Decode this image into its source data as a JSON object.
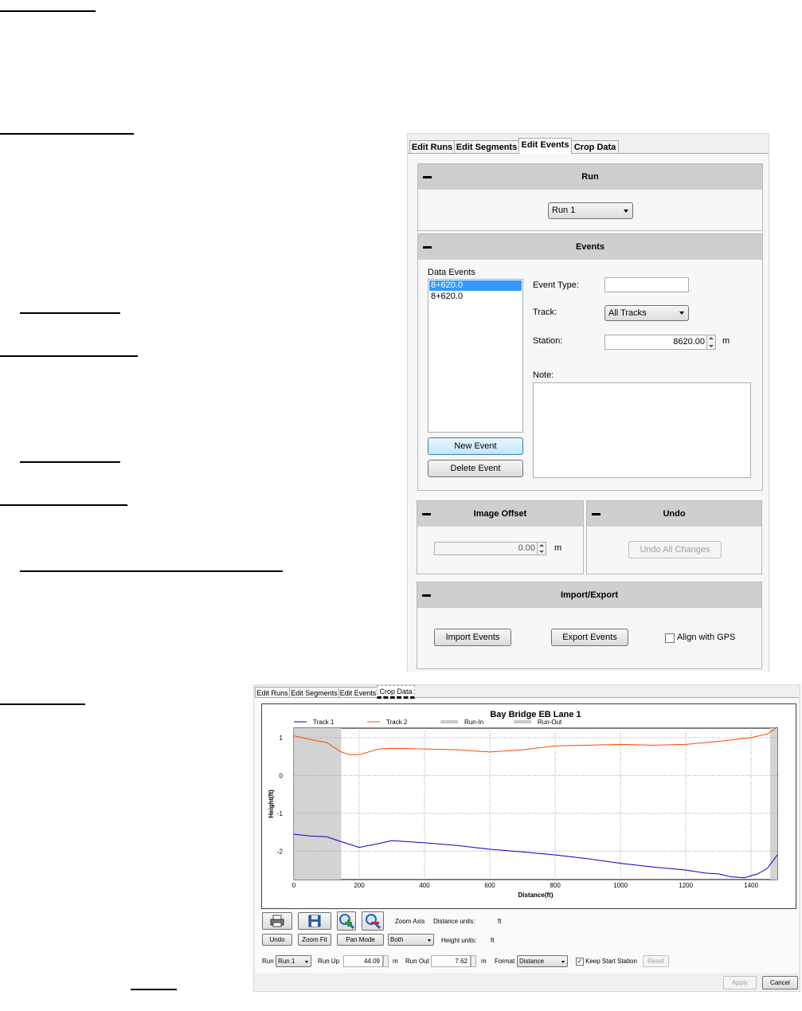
{
  "edit_events_panel": {
    "tabs": [
      "Edit Runs",
      "Edit Segments",
      "Edit Events",
      "Crop Data"
    ],
    "active_tab": "Edit Events",
    "run_group": {
      "title": "Run",
      "run_value": "Run 1"
    },
    "events_group": {
      "title": "Events",
      "data_events_label": "Data Events",
      "events_list": [
        "8+620.0",
        "8+620.0"
      ],
      "selected_event": "8+620.0",
      "event_type_label": "Event Type:",
      "event_type_value": "",
      "track_label": "Track:",
      "track_value": "All Tracks",
      "station_label": "Station:",
      "station_value": "8620.00",
      "station_unit": "m",
      "note_label": "Note:",
      "note_value": "",
      "new_event_button": "New Event",
      "delete_event_button": "Delete Event"
    },
    "image_offset_group": {
      "title": "Image Offset",
      "value": "0.00",
      "unit": "m"
    },
    "undo_group": {
      "title": "Undo",
      "undo_all_button": "Undo All Changes"
    },
    "import_export_group": {
      "title": "Import/Export",
      "import_button": "Import Events",
      "export_button": "Export Events",
      "align_gps_label": "Align with GPS",
      "align_gps_checked": false
    }
  },
  "crop_data_panel": {
    "tabs": [
      "Edit Runs",
      "Edit Segments",
      "Edit Events",
      "Crop Data"
    ],
    "active_tab": "Crop Data",
    "toolbar": {
      "zoom_axis_label": "Zoom Axis",
      "distance_units_label": "Distance units:",
      "distance_units_value": "ft",
      "height_units_label": "Height units:",
      "height_units_value": "ft",
      "undo_button": "Undo",
      "zoom_fit_button": "Zoom Fit",
      "pan_mode_button": "Pan Mode",
      "zoom_axis_value": "Both",
      "print_icon": "printer-icon",
      "save_icon": "floppy-disk-icon",
      "zoom_in_icon": "zoom-in-icon",
      "zoom_out_icon": "zoom-out-icon"
    },
    "bottom_bar": {
      "run_label": "Run",
      "run_value": "Run 1",
      "run_up_label": "Run Up",
      "run_up_value": "44.09",
      "run_up_unit": "m",
      "run_out_label": "Run Out",
      "run_out_value": "7.62",
      "run_out_unit": "m",
      "format_label": "Format",
      "format_value": "Distance",
      "keep_start_label": "Keep Start Station",
      "keep_start_checked": true,
      "reset_button": "Reset"
    },
    "apply_button": "Apply",
    "cancel_button": "Cancel"
  },
  "chart_data": {
    "type": "line",
    "title": "Bay Bridge EB Lane 1",
    "xlabel": "Distance(ft)",
    "ylabel": "Height(ft)",
    "xlim": [
      0,
      1480
    ],
    "ylim": [
      -2.75,
      1.25
    ],
    "xticks": [
      0,
      200,
      400,
      600,
      800,
      1000,
      1200,
      1400
    ],
    "yticks": [
      1,
      0,
      -1,
      -2
    ],
    "grid": true,
    "legend_position": "top",
    "legend": [
      "Track 1",
      "Track 2",
      "Run-In",
      "Run-Out"
    ],
    "run_in_range": [
      0,
      145
    ],
    "run_out_range": [
      1458,
      1480
    ],
    "series": [
      {
        "name": "Track 1",
        "color": "#0000cc",
        "x": [
          0,
          50,
          100,
          145,
          200,
          260,
          300,
          400,
          500,
          600,
          700,
          800,
          900,
          1000,
          1100,
          1200,
          1260,
          1300,
          1340,
          1380,
          1420,
          1450,
          1480
        ],
        "y": [
          -1.55,
          -1.6,
          -1.62,
          -1.75,
          -1.9,
          -1.8,
          -1.72,
          -1.78,
          -1.85,
          -1.95,
          -2.02,
          -2.1,
          -2.2,
          -2.32,
          -2.42,
          -2.5,
          -2.58,
          -2.6,
          -2.68,
          -2.7,
          -2.6,
          -2.45,
          -2.1
        ]
      },
      {
        "name": "Track 2",
        "color": "#ff4500",
        "x": [
          0,
          50,
          100,
          145,
          170,
          200,
          260,
          300,
          400,
          500,
          600,
          700,
          800,
          900,
          1000,
          1100,
          1200,
          1300,
          1400,
          1450,
          1480
        ],
        "y": [
          1.05,
          0.95,
          0.87,
          0.62,
          0.55,
          0.55,
          0.7,
          0.72,
          0.7,
          0.68,
          0.62,
          0.68,
          0.78,
          0.8,
          0.82,
          0.8,
          0.82,
          0.9,
          1.0,
          1.1,
          1.28
        ]
      }
    ]
  }
}
